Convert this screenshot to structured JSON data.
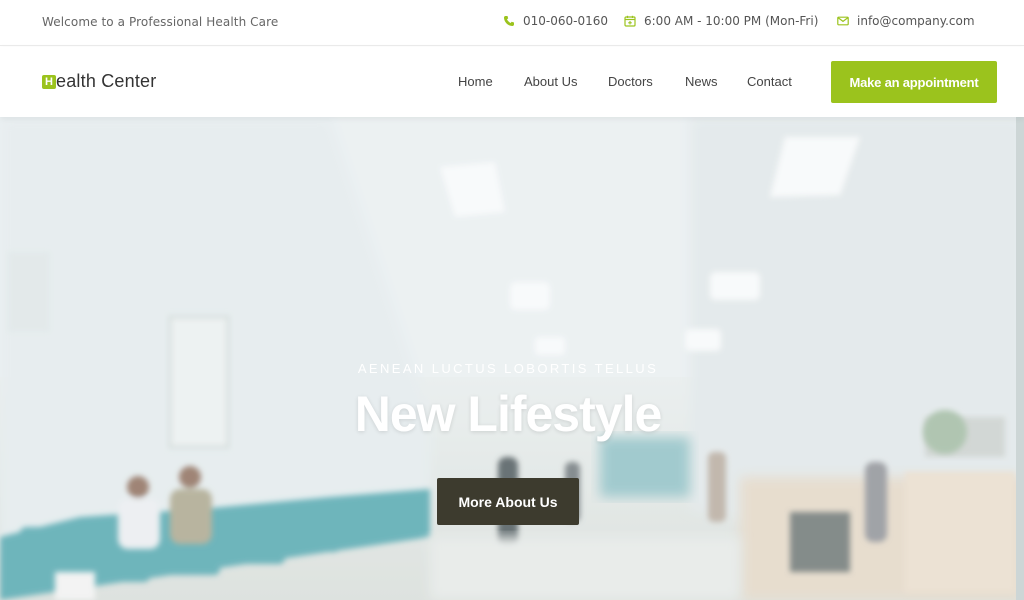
{
  "topbar": {
    "welcome": "Welcome to a Professional Health Care",
    "phone": "010-060-0160",
    "hours": "6:00 AM - 10:00 PM (Mon-Fri)",
    "email": "info@company.com"
  },
  "header": {
    "logo_mark": "H",
    "logo_text": "ealth Center",
    "nav": [
      "Home",
      "About Us",
      "Doctors",
      "News",
      "Contact"
    ],
    "cta": "Make an appointment"
  },
  "hero": {
    "kicker": "AENEAN LUCTUS LOBORTIS TELLUS",
    "title": "New Lifestyle",
    "button": "More About Us"
  },
  "colors": {
    "accent": "#9bc31d",
    "dark_button": "#3d3b2e"
  },
  "icons": {
    "phone": "phone-icon",
    "hours": "calendar-icon",
    "email": "envelope-icon"
  }
}
